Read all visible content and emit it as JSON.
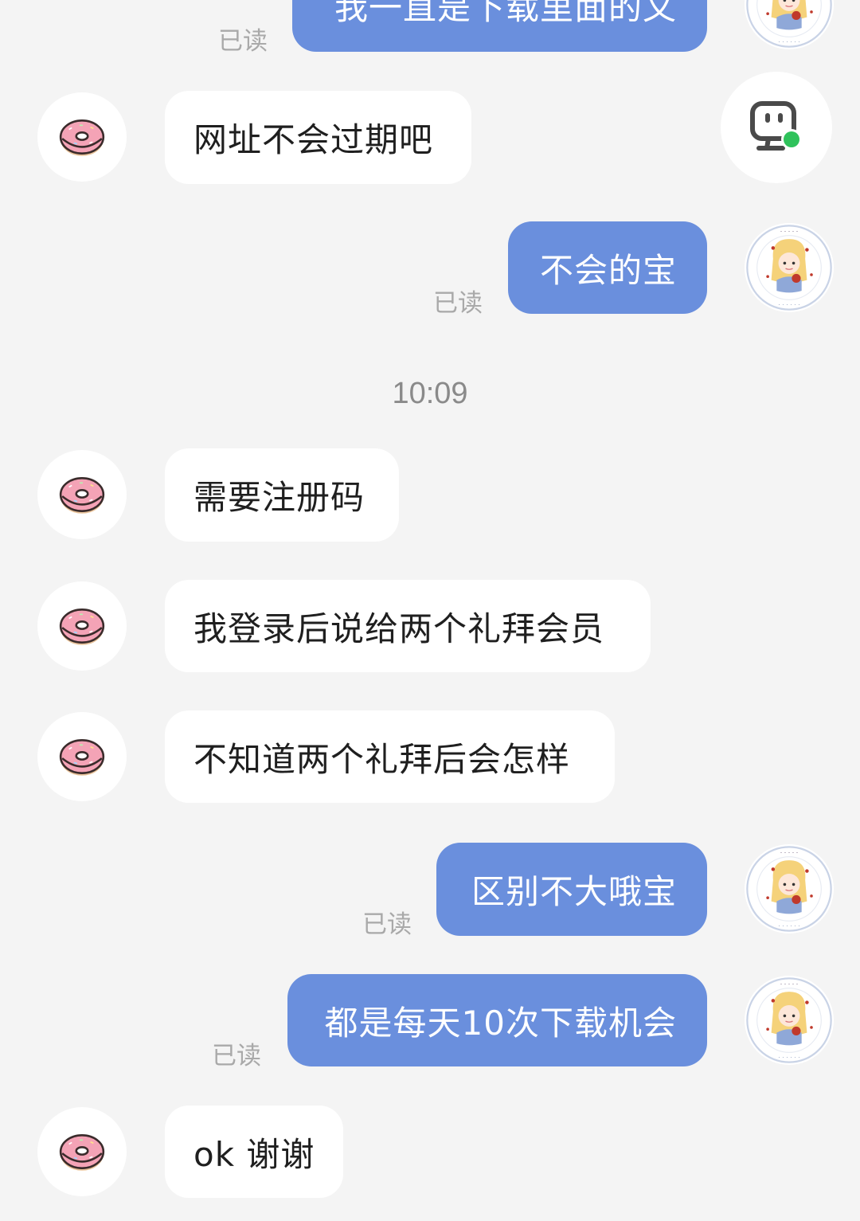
{
  "messages": {
    "m0": {
      "text": "我一直是下载里面的文",
      "read": "已读"
    },
    "m1": {
      "text": "网址不会过期吧"
    },
    "m2": {
      "text": "不会的宝",
      "read": "已读"
    },
    "time": "10:09",
    "m3": {
      "text": "需要注册码"
    },
    "m4": {
      "text": "我登录后说给两个礼拜会员"
    },
    "m5": {
      "text": "不知道两个礼拜后会怎样"
    },
    "m6": {
      "text": "区别不大哦宝",
      "read": "已读"
    },
    "m7": {
      "text": "都是每天10次下载机会",
      "read": "已读"
    },
    "m8": {
      "text": "ok 谢谢"
    }
  },
  "icons": {
    "incoming_avatar": "donut-avatar-icon",
    "outgoing_avatar": "girl-sticker-avatar-icon",
    "floating_button": "robot-assistant-icon"
  },
  "colors": {
    "background": "#f4f4f4",
    "outgoing_bubble": "#6a8fdd",
    "incoming_bubble": "#ffffff",
    "online_dot": "#2fc25b"
  }
}
